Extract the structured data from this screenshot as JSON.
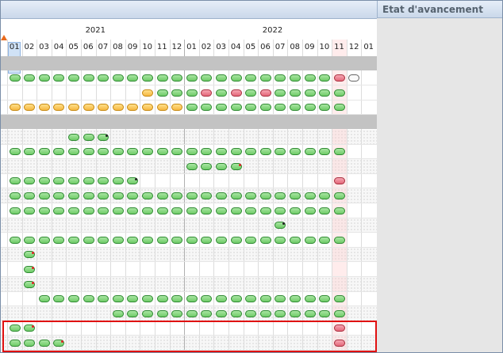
{
  "panel": {
    "title": "Etat d'avancement"
  },
  "years": [
    "2021",
    "2022"
  ],
  "months": [
    "01",
    "02",
    "03",
    "04",
    "05",
    "06",
    "07",
    "08",
    "09",
    "10",
    "11",
    "12",
    "01",
    "02",
    "03",
    "04",
    "05",
    "06",
    "07",
    "08",
    "09",
    "10",
    "11",
    "12",
    "01"
  ],
  "colors": {
    "green": "#6fcb68",
    "orange": "#f6b741",
    "red": "#e4687a",
    "highlight_box": "#e01010"
  },
  "rows": [
    {
      "kind": "gray",
      "cells": []
    },
    {
      "kind": "data",
      "cells": [
        "g",
        "g",
        "g",
        "g",
        "g",
        "g",
        "g",
        "g",
        "g",
        "g",
        "g",
        "g",
        "g",
        "g",
        "g",
        "g",
        "g",
        "g",
        "g",
        "g",
        "g",
        "g",
        "r",
        "w"
      ]
    },
    {
      "kind": "data",
      "cells": [
        null,
        null,
        null,
        null,
        null,
        null,
        null,
        null,
        null,
        "o",
        "g",
        "g",
        "g",
        "r",
        "g",
        "r",
        "g",
        "r",
        "g",
        "g",
        "g",
        "g",
        "g"
      ]
    },
    {
      "kind": "data",
      "cells": [
        "o",
        "o",
        "o",
        "o",
        "o",
        "o",
        "o",
        "o",
        "o",
        "o",
        "o",
        "o",
        "g",
        "g",
        "g",
        "g",
        "g",
        "g",
        "g",
        "g",
        "g",
        "g",
        "g"
      ]
    },
    {
      "kind": "gray",
      "cells": []
    },
    {
      "kind": "data",
      "cells": [
        null,
        null,
        null,
        null,
        "g",
        "g",
        "g*"
      ]
    },
    {
      "kind": "data",
      "cells": [
        "g",
        "g",
        "g",
        "g",
        "g",
        "g",
        "g",
        "g",
        "g",
        "g",
        "g",
        "g",
        "g",
        "g",
        "g",
        "g",
        "g",
        "g",
        "g",
        "g",
        "g",
        "g",
        "g"
      ]
    },
    {
      "kind": "data",
      "cells": [
        null,
        null,
        null,
        null,
        null,
        null,
        null,
        null,
        null,
        null,
        null,
        null,
        "g",
        "g",
        "g",
        "g+"
      ]
    },
    {
      "kind": "data",
      "cells": [
        "g",
        "g",
        "g",
        "g",
        "g",
        "g",
        "g",
        "g",
        "g*",
        null,
        null,
        null,
        null,
        null,
        null,
        null,
        null,
        null,
        null,
        null,
        null,
        null,
        "r"
      ]
    },
    {
      "kind": "data",
      "cells": [
        "g",
        "g",
        "g",
        "g",
        "g",
        "g",
        "g",
        "g",
        "g",
        "g",
        "g",
        "g",
        "g",
        "g",
        "g",
        "g",
        "g",
        "g",
        "g",
        "g",
        "g",
        "g",
        "g"
      ]
    },
    {
      "kind": "data",
      "cells": [
        "g",
        "g",
        "g",
        "g",
        "g",
        "g",
        "g",
        "g",
        "g",
        "g",
        "g",
        "g",
        "g",
        "g",
        "g",
        "g",
        "g",
        "g",
        "g",
        "g",
        "g",
        "g",
        "g"
      ]
    },
    {
      "kind": "data",
      "cells": [
        null,
        null,
        null,
        null,
        null,
        null,
        null,
        null,
        null,
        null,
        null,
        null,
        null,
        null,
        null,
        null,
        null,
        null,
        "g*"
      ]
    },
    {
      "kind": "data",
      "cells": [
        "g",
        "g",
        "g",
        "g",
        "g",
        "g",
        "g",
        "g",
        "g",
        "g",
        "g",
        "g",
        "g",
        "g",
        "g",
        "g",
        "g",
        "g",
        "g",
        "g",
        "g",
        "g",
        "g"
      ]
    },
    {
      "kind": "data",
      "cells": [
        null,
        "g+"
      ]
    },
    {
      "kind": "data",
      "cells": [
        null,
        "g+"
      ]
    },
    {
      "kind": "data",
      "cells": [
        null,
        "g+"
      ]
    },
    {
      "kind": "data",
      "cells": [
        null,
        null,
        "g",
        "g",
        "g",
        "g",
        "g",
        "g",
        "g",
        "g",
        "g",
        "g",
        "g",
        "g",
        "g",
        "g",
        "g",
        "g",
        "g",
        "g",
        "g",
        "g",
        "g"
      ]
    },
    {
      "kind": "data",
      "cells": [
        null,
        null,
        null,
        null,
        null,
        null,
        null,
        "g",
        "g",
        "g",
        "g",
        "g",
        "g",
        "g",
        "g",
        "g",
        "g",
        "g",
        "g",
        "g",
        "g",
        "g",
        "g"
      ]
    },
    {
      "kind": "data",
      "cells": [
        "g",
        "g+",
        null,
        null,
        null,
        null,
        null,
        null,
        null,
        null,
        null,
        null,
        null,
        null,
        null,
        null,
        null,
        null,
        null,
        null,
        null,
        null,
        "r"
      ]
    },
    {
      "kind": "data",
      "cells": [
        "g",
        "g",
        "g",
        "g+",
        null,
        null,
        null,
        null,
        null,
        null,
        null,
        null,
        null,
        null,
        null,
        null,
        null,
        null,
        null,
        null,
        null,
        null,
        "r"
      ]
    }
  ]
}
